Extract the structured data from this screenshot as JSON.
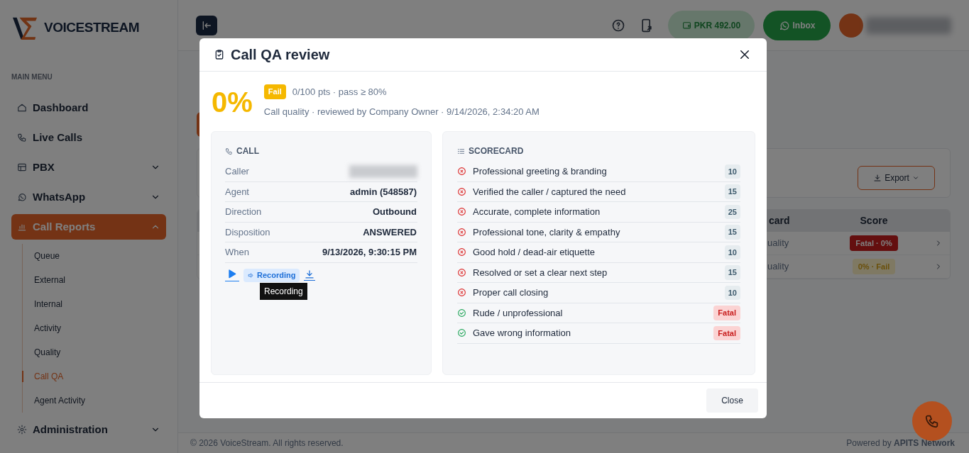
{
  "sidebar": {
    "brand": "VOICESTREAM",
    "section_label": "MAIN MENU",
    "items": [
      {
        "label": "Dashboard",
        "kind": "link",
        "selected": false
      },
      {
        "label": "Live Calls",
        "kind": "link",
        "selected": false
      },
      {
        "label": "PBX",
        "kind": "group",
        "selected": false,
        "expanded": false
      },
      {
        "label": "WhatsApp",
        "kind": "group",
        "selected": false,
        "expanded": false
      },
      {
        "label": "Call Reports",
        "kind": "group",
        "selected": true,
        "expanded": true,
        "children": [
          {
            "label": "Queue",
            "selected": false
          },
          {
            "label": "External",
            "selected": false
          },
          {
            "label": "Internal",
            "selected": false
          },
          {
            "label": "Activity",
            "selected": false
          },
          {
            "label": "Quality",
            "selected": false
          },
          {
            "label": "Call QA",
            "selected": true
          },
          {
            "label": "Agent Activity",
            "selected": false
          }
        ]
      },
      {
        "label": "Administration",
        "kind": "group",
        "selected": false,
        "expanded": false
      }
    ]
  },
  "topbar": {
    "balance": "PKR 492.00",
    "inbox": "Inbox"
  },
  "page": {
    "export": "Export",
    "table": {
      "columns": [
        "card",
        "Score"
      ],
      "rows": [
        {
          "column_1": "uality",
          "score": "Fatal · 0%",
          "kind": "fatal"
        },
        {
          "column_1": "uality",
          "score": "0% · Fail",
          "kind": "fail"
        }
      ]
    }
  },
  "footer": {
    "copyright": "© 2026 VoiceStream. All rights reserved.",
    "powered": "Powered by **APITS Network**"
  },
  "modal": {
    "title": "Call QA review",
    "score": "0%",
    "verdict": "Fail",
    "summary": "0/100 pts · pass ≥ 80%",
    "meta": "Call quality · reviewed by Company Owner · 9/14/2026, 2:34:20 AM",
    "call": {
      "heading": "CALL",
      "fields": [
        {
          "label": "Caller",
          "redacted": true
        },
        {
          "label": "Agent",
          "value": "admin (548587)",
          "redacted": false
        },
        {
          "label": "Direction",
          "value": "Outbound",
          "redacted": false
        },
        {
          "label": "Disposition",
          "value": "ANSWERED",
          "redacted": false
        },
        {
          "label": "When",
          "value": "9/13/2026, 9:30:15 PM",
          "redacted": false
        }
      ],
      "recording": "Recording",
      "tooltip": "Recording"
    },
    "scorecard": {
      "heading": "SCORECARD",
      "items": [
        {
          "label": "Professional greeting & branding",
          "passed": false,
          "kind": "points",
          "badge": "10"
        },
        {
          "label": "Verified the caller / captured the need",
          "passed": false,
          "kind": "points",
          "badge": "15"
        },
        {
          "label": "Accurate, complete information",
          "passed": false,
          "kind": "points",
          "badge": "25"
        },
        {
          "label": "Professional tone, clarity & empathy",
          "passed": false,
          "kind": "points",
          "badge": "15"
        },
        {
          "label": "Good hold / dead-air etiquette",
          "passed": false,
          "kind": "points",
          "badge": "10"
        },
        {
          "label": "Resolved or set a clear next step",
          "passed": false,
          "kind": "points",
          "badge": "15"
        },
        {
          "label": "Proper call closing",
          "passed": false,
          "kind": "points",
          "badge": "10"
        },
        {
          "label": "Rude / unprofessional",
          "passed": true,
          "kind": "fatal",
          "badge": "Fatal"
        },
        {
          "label": "Gave wrong information",
          "passed": true,
          "kind": "fatal",
          "badge": "Fatal"
        }
      ]
    },
    "close": "Close"
  }
}
